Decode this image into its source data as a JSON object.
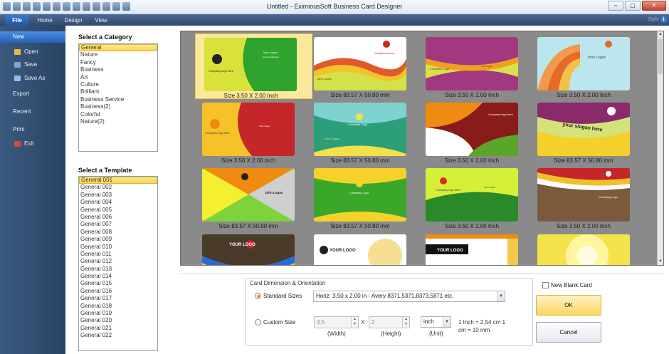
{
  "window": {
    "title": "Untitled - EximiousSoft Business Card Designer",
    "close_glyph": "✕",
    "min_glyph": "–",
    "max_glyph": "▢"
  },
  "menu": {
    "tabs": [
      "File",
      "Home",
      "Design",
      "View"
    ],
    "style_label": "Style",
    "help_glyph": "i"
  },
  "sidebar": {
    "items": [
      {
        "label": "New",
        "icon": "new-icon"
      },
      {
        "label": "Open",
        "icon": "open-folder-icon"
      },
      {
        "label": "Save",
        "icon": "save-icon"
      },
      {
        "label": "Save As",
        "icon": "save-as-icon"
      },
      {
        "label": "Export",
        "icon": ""
      },
      {
        "label": "Recent",
        "icon": ""
      },
      {
        "label": "Print",
        "icon": ""
      },
      {
        "label": "Exit",
        "icon": "exit-icon"
      }
    ]
  },
  "categories": {
    "title": "Select a Category",
    "items": [
      "General",
      "Nature",
      "Fancy",
      "Business",
      "Art",
      "Culture",
      "Brilliant",
      "Business Service",
      "Business(2)",
      "Colorful",
      "Nature(2)"
    ],
    "selected": "General"
  },
  "templates": {
    "title": "Select a Template",
    "items": [
      "General 001",
      "General 002",
      "General 003",
      "General 004",
      "General 005",
      "General 006",
      "General 007",
      "General 008",
      "General 009",
      "General 010",
      "General 011",
      "General 012",
      "General 013",
      "General 014",
      "General 015",
      "General 016",
      "General 017",
      "General 018",
      "General 019",
      "General 020",
      "General 021",
      "General 022"
    ],
    "selected": "General 001"
  },
  "gallery": {
    "cards": [
      {
        "caption": "Size 3.50 X 2.00 Inch",
        "style": "green-yellow",
        "text": "Company logo here"
      },
      {
        "caption": "Size 83.57 X 50.80 mm",
        "style": "wave-red",
        "text": "Vesteportal.com"
      },
      {
        "caption": "Size 3.50 X 2.00 Inch",
        "style": "purple-wave",
        "text": "Company Logo"
      },
      {
        "caption": "Size 3.50 X 2.00 Inch",
        "style": "teal-arcs",
        "text": "John Logan"
      },
      {
        "caption": "Size 3.50 X 2.00 Inch",
        "style": "red-yellow",
        "text": "Company logo here"
      },
      {
        "caption": "Size 83.57 X 50.80 mm",
        "style": "teal-green",
        "text": "Company Logo"
      },
      {
        "caption": "Size 3.50 X 2.00 Inch",
        "style": "orange-green",
        "text": "Company logo here"
      },
      {
        "caption": "Size 83.57 X 50.80 mm",
        "style": "slogan",
        "text": "your slogan here"
      },
      {
        "caption": "Size 83.57 X 50.80 mm",
        "style": "green-x",
        "text": "John Logan"
      },
      {
        "caption": "Size 83.57 X 50.80 mm",
        "style": "green-frame",
        "text": "Company Logo"
      },
      {
        "caption": "Size 3.50 X 2.00 Inch",
        "style": "yellow-green",
        "text": "Company logo here"
      },
      {
        "caption": "Size 3.50 X 2.00 Inch",
        "style": "brown-wave",
        "text": "Company Logo"
      },
      {
        "caption": "",
        "style": "brown-logo",
        "text": "YOUR LOGO"
      },
      {
        "caption": "",
        "style": "white-logo",
        "text": "YOUR LOGO"
      },
      {
        "caption": "",
        "style": "bars-logo",
        "text": "YOUR LOGO"
      },
      {
        "caption": "",
        "style": "sunburst",
        "text": ""
      }
    ]
  },
  "dimension": {
    "group_title": "Card Dimension & Orientation",
    "standard_label": "Standard Sizes",
    "standard_value": "Horiz: 3.50 x 2.00 in - Avery 8371,5371,8373,5871 etc.",
    "custom_label": "Custom Size",
    "width_value": "3.5",
    "height_value": "2",
    "unit_value": "inch",
    "x_sep": "X",
    "width_label": "(Width)",
    "height_label": "(Height)",
    "unit_label": "(Unit)",
    "conversion_line1": "1 Inch = 2.54 cm  1",
    "conversion_line2": "cm = 10 mm"
  },
  "actions": {
    "blank_label": "New Blank Card",
    "ok_label": "OK",
    "cancel_label": "Cancel"
  }
}
